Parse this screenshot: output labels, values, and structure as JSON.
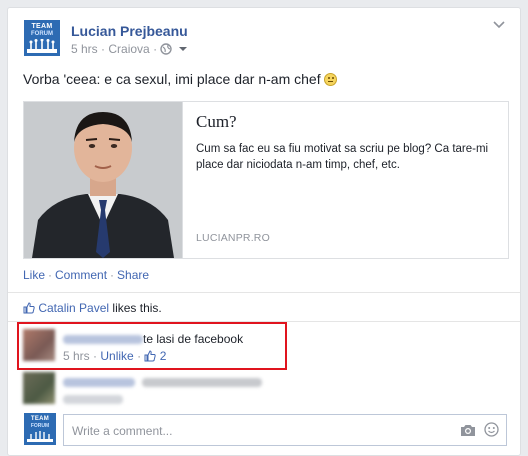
{
  "post": {
    "author": "Lucian Prejbeanu",
    "time": "5 hrs",
    "meta_sep": "·",
    "location": "Craiova",
    "text": "Vorba 'ceea: e ca sexul, imi place dar n-am chef",
    "avatar_logo": "FORUM",
    "avatar_logo_top": "TEAM"
  },
  "link_preview": {
    "title": "Cum?",
    "description": "Cum sa fac eu sa fiu motivat sa scriu pe blog? Ca tare-mi place dar niciodata n-am timp, chef, etc.",
    "domain": "LUCIANPR.RO"
  },
  "actions": {
    "like": "Like",
    "comment": "Comment",
    "share": "Share",
    "sep": "·"
  },
  "likes": {
    "person": "Catalin Pavel",
    "suffix": "likes this."
  },
  "comments": [
    {
      "text": "te lasi de facebook",
      "time": "5 hrs",
      "unlike": "Unlike",
      "like_count": "2",
      "sep": "·"
    },
    {
      "time": "",
      "sep": "·"
    }
  ],
  "composer": {
    "placeholder": "Write a comment..."
  },
  "colors": {
    "brand_blue": "#4267b2",
    "author_blue": "#365899",
    "highlight_red": "#e0141e"
  }
}
